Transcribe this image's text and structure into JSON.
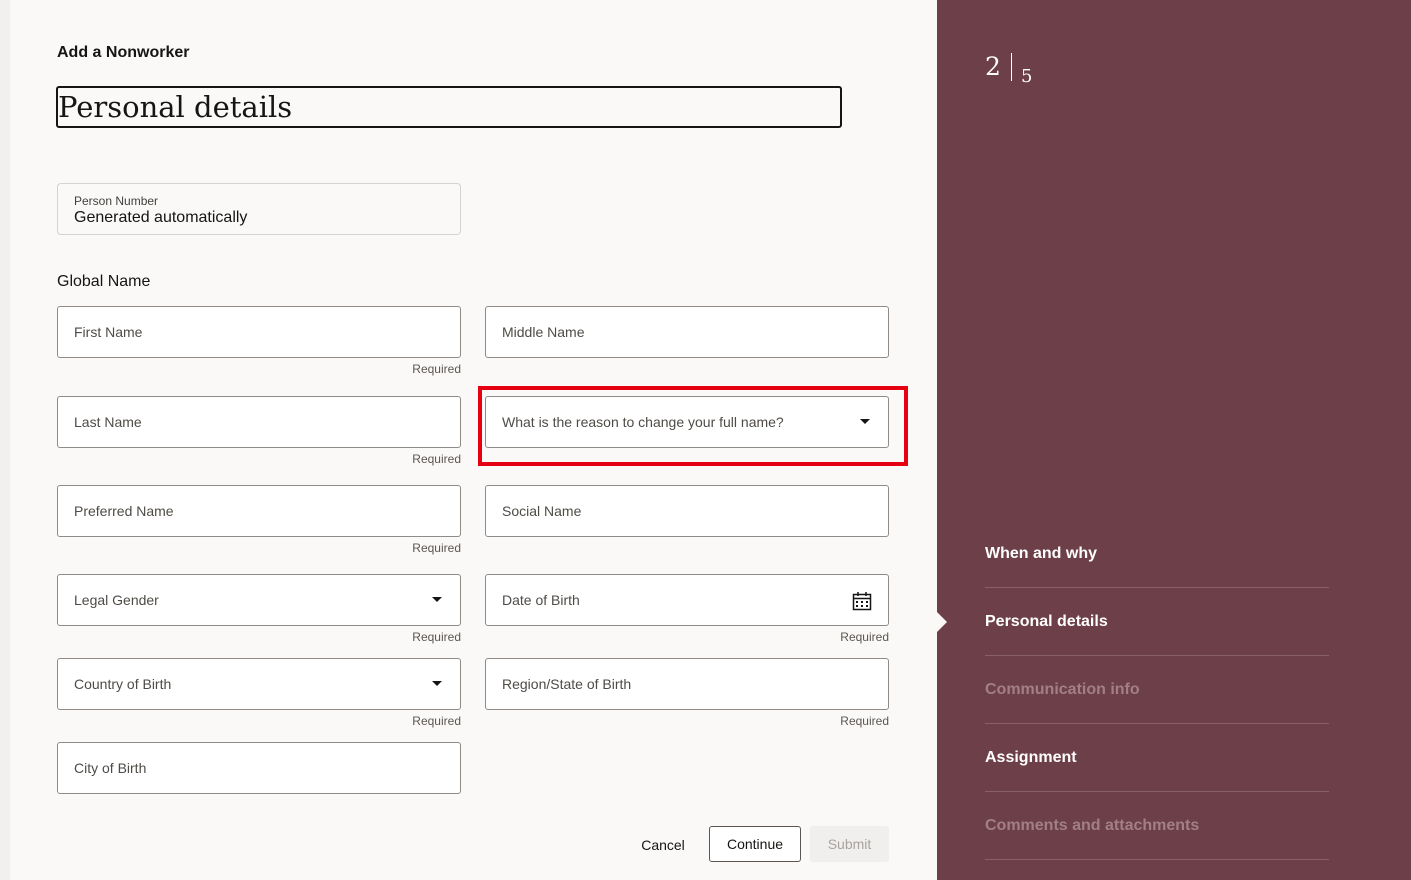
{
  "header": {
    "subtitle": "Add a Nonworker",
    "title": "Personal details"
  },
  "person_number": {
    "label": "Person Number",
    "value": "Generated automatically"
  },
  "global_name": {
    "heading": "Global Name"
  },
  "fields": {
    "first_name": "First Name",
    "middle_name": "Middle Name",
    "last_name": "Last Name",
    "name_change_reason": "What is the reason to change your full name?",
    "preferred_name": "Preferred Name",
    "social_name": "Social Name",
    "legal_gender": "Legal Gender",
    "date_of_birth": "Date of Birth",
    "country_of_birth": "Country of Birth",
    "region_of_birth": "Region/State of Birth",
    "city_of_birth": "City of Birth"
  },
  "required_label": "Required",
  "buttons": {
    "cancel": "Cancel",
    "continue": "Continue",
    "submit": "Submit"
  },
  "progress": {
    "current": "2",
    "total": "5"
  },
  "steps": [
    {
      "label": "When and why",
      "state": "complete"
    },
    {
      "label": "Personal details",
      "state": "current"
    },
    {
      "label": "Communication info",
      "state": "disabled"
    },
    {
      "label": "Assignment",
      "state": "complete"
    },
    {
      "label": "Comments and attachments",
      "state": "disabled"
    }
  ],
  "icons": {
    "dropdown": "chevron-down-icon",
    "calendar": "calendar-icon"
  },
  "colors": {
    "sidebar_bg": "#6d3f48",
    "highlight": "#e50012",
    "page_bg": "#fbf9f8"
  }
}
